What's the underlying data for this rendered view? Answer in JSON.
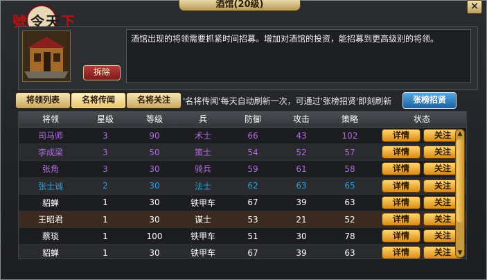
{
  "window": {
    "title": "酒馆(20级)",
    "close_label": "✕"
  },
  "logo": {
    "text": "號令天下"
  },
  "info": {
    "demolish_label": "拆除",
    "description": "酒馆出现的将领需要抓紧时间招募。增加对酒馆的投资，能招募到更高级别的将领。"
  },
  "tabs": [
    {
      "label": "将领列表"
    },
    {
      "label": "名将传闻"
    },
    {
      "label": "名将关注"
    }
  ],
  "tip": "'名将传闻'每天自动刷新一次，可通过'张榜招贤'即刻刷新",
  "recruit_label": "张榜招贤",
  "table": {
    "headers": [
      "将领",
      "星级",
      "等级",
      "兵",
      "防御",
      "攻击",
      "策略",
      "状态"
    ],
    "detail_label": "详情",
    "follow_label": "关注",
    "rows": [
      {
        "name": "司马师",
        "star": "3",
        "level": "90",
        "troop": "术士",
        "def": "66",
        "atk": "43",
        "strat": "102",
        "color": "#b06ae0"
      },
      {
        "name": "李成梁",
        "star": "3",
        "level": "50",
        "troop": "策士",
        "def": "54",
        "atk": "52",
        "strat": "57",
        "color": "#b06ae0"
      },
      {
        "name": "张角",
        "star": "3",
        "level": "30",
        "troop": "骑兵",
        "def": "59",
        "atk": "61",
        "strat": "58",
        "color": "#b06ae0"
      },
      {
        "name": "张士诚",
        "star": "2",
        "level": "30",
        "troop": "法士",
        "def": "62",
        "atk": "63",
        "strat": "65",
        "color": "#2aa0e0"
      },
      {
        "name": "貂蝉",
        "star": "1",
        "level": "30",
        "troop": "铁甲车",
        "def": "67",
        "atk": "39",
        "strat": "63",
        "color": "#ffffff"
      },
      {
        "name": "王昭君",
        "star": "1",
        "level": "30",
        "troop": "谋士",
        "def": "53",
        "atk": "21",
        "strat": "52",
        "color": "#ffffff"
      },
      {
        "name": "蔡琰",
        "star": "1",
        "level": "100",
        "troop": "铁甲车",
        "def": "51",
        "atk": "30",
        "strat": "78",
        "color": "#ffffff"
      },
      {
        "name": "貂蝉",
        "star": "1",
        "level": "30",
        "troop": "铁甲车",
        "def": "67",
        "atk": "39",
        "strat": "63",
        "color": "#ffffff"
      }
    ]
  },
  "icons": {
    "scroll_up": "arrow-up-icon",
    "scroll_down": "arrow-down-icon",
    "close": "close-icon"
  }
}
